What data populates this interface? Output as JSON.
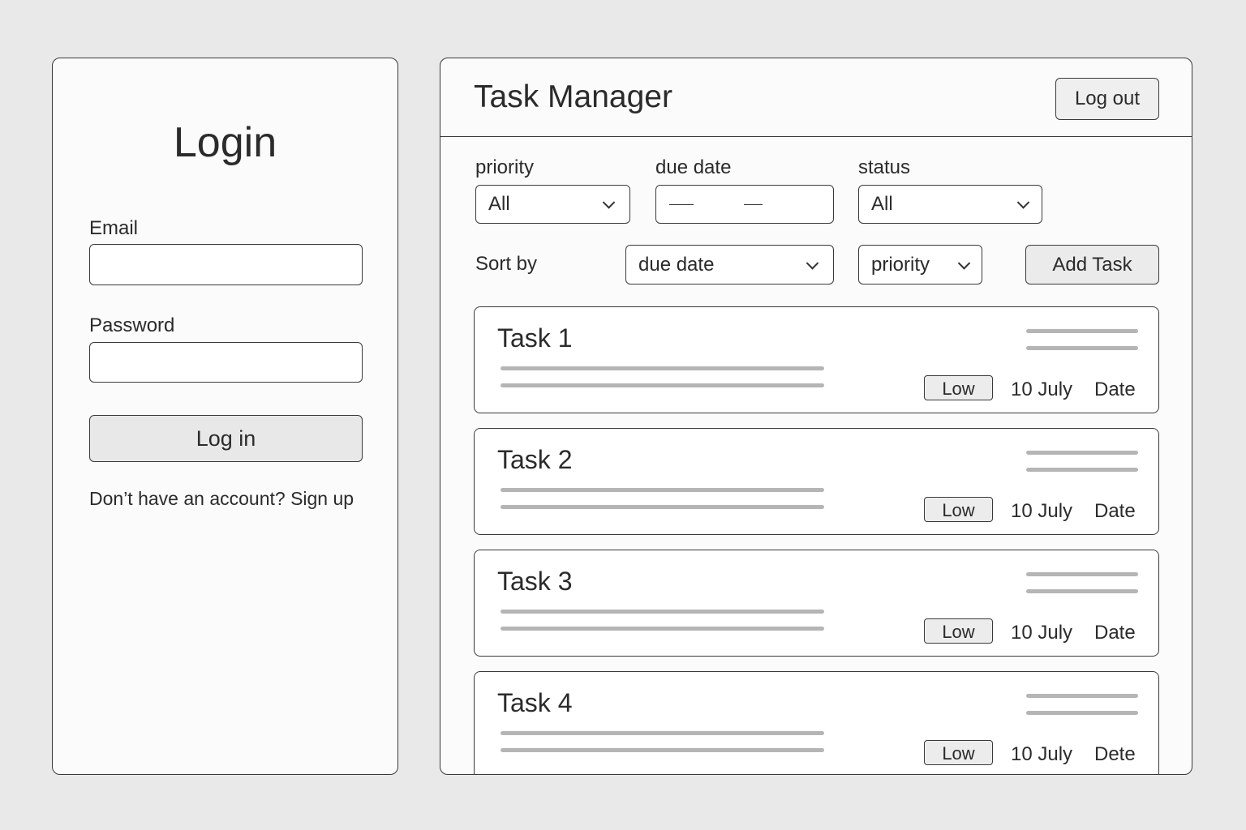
{
  "login": {
    "title": "Login",
    "email_label": "Email",
    "email_value": "",
    "password_label": "Password",
    "password_value": "",
    "login_button": "Log in",
    "signup_prompt": "Don’t have an account?",
    "signup_link": "Sign up"
  },
  "task_manager": {
    "title": "Task Manager",
    "logout_button": "Log out",
    "filters": {
      "priority_label": "priority",
      "priority_value": "All",
      "due_date_label": "due date",
      "status_label": "status",
      "status_value": "All"
    },
    "sort": {
      "label": "Sort by",
      "primary": "due date",
      "secondary": "priority"
    },
    "add_task_button": "Add Task",
    "tasks": [
      {
        "title": "Task 1",
        "priority": "Low",
        "date": "10 July",
        "date_label": "Date"
      },
      {
        "title": "Task 2",
        "priority": "Low",
        "date": "10 July",
        "date_label": "Date"
      },
      {
        "title": "Task 3",
        "priority": "Low",
        "date": "10 July",
        "date_label": "Date"
      },
      {
        "title": "Task 4",
        "priority": "Low",
        "date": "10 July",
        "date_label": "Dete"
      }
    ]
  }
}
